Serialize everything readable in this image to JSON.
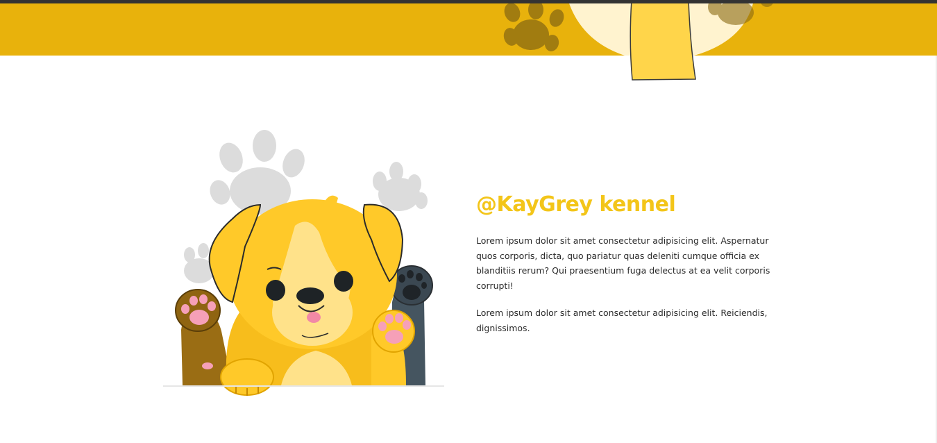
{
  "header": {
    "band_color": "#e8b20c",
    "decoration": "paw-prints-and-tail-icon"
  },
  "hero": {
    "illustration": "puppy-waving-paws-icon"
  },
  "intro": {
    "title": "@KayGrey kennel",
    "title_color": "#f3c519",
    "paragraph_1": "Lorem ipsum dolor sit amet consectetur adipisicing elit. Aspernatur quos corporis, dicta, quo pariatur quas deleniti cumque officia ex blanditiis rerum? Qui praesentium fuga delectus at ea velit corporis corrupti!",
    "paragraph_2": "Lorem ipsum dolor sit amet consectetur adipisicing elit. Reiciendis, dignissimos."
  }
}
